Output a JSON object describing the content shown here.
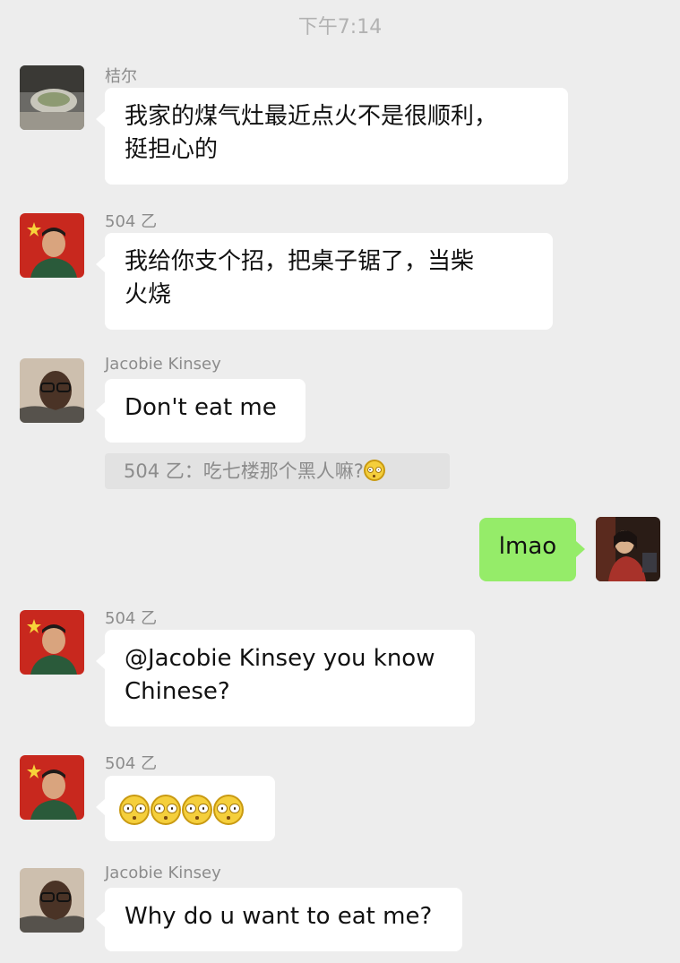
{
  "header": {
    "time": "下午7:14"
  },
  "messages": [
    {
      "sender": "桔尔",
      "text": "我家的煤气灶最近点火不是很顺利，",
      "text2": "挺担心的"
    },
    {
      "sender": "504 乙",
      "text": "我给你支个招，把桌子锯了，当柴",
      "text2": "火烧"
    },
    {
      "sender": "Jacobie Kinsey",
      "text": "Don't eat me",
      "quote": "504 乙：吃七楼那个黑人嘛?",
      "quote_emoji": "flushed-emoji"
    },
    {
      "sender": "self",
      "text": "lmao"
    },
    {
      "sender": "504 乙",
      "text": "@Jacobie Kinsey you know",
      "text2": "Chinese?"
    },
    {
      "sender": "504 乙",
      "emoji": "flushed-emoji",
      "emoji_count": 4
    },
    {
      "sender": "Jacobie Kinsey",
      "text": "Why do u want to eat me?"
    }
  ],
  "colors": {
    "background": "#ededed",
    "incoming_bubble": "#ffffff",
    "outgoing_bubble": "#95ec69"
  }
}
